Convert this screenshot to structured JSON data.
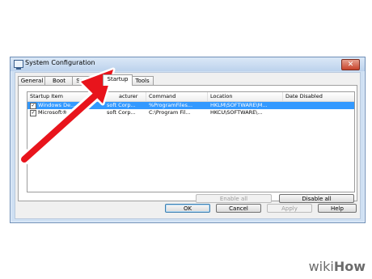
{
  "window": {
    "title": "System Configuration",
    "close_glyph": "✕"
  },
  "tabs": [
    {
      "label": "General"
    },
    {
      "label": "Boot"
    },
    {
      "label": "Services"
    },
    {
      "label": "Startup",
      "active": true
    },
    {
      "label": "Tools"
    }
  ],
  "table": {
    "columns": [
      "Startup Item",
      "Manufacturer",
      "Command",
      "Location",
      "Date Disabled"
    ],
    "header_visible": [
      "Startup Item",
      "acturer",
      "Command",
      "Location",
      "Date Disabled"
    ],
    "rows": [
      {
        "checked": true,
        "item": "Windows De...",
        "manufacturer": "soft Corp...",
        "command": "%ProgramFiles...",
        "location": "HKLM\\SOFTWARE\\M...",
        "date_disabled": "",
        "selected": true
      },
      {
        "checked": true,
        "item": "Microsoft®...",
        "manufacturer": "soft Corp...",
        "command": "C:\\Program Fil...",
        "location": "HKCU\\SOFTWARE\\...",
        "date_disabled": "",
        "selected": false
      }
    ]
  },
  "buttons": {
    "enable_all": "Enable all",
    "disable_all": "Disable all",
    "ok": "OK",
    "cancel": "Cancel",
    "apply": "Apply",
    "help": "Help"
  },
  "logo": {
    "wiki": "wiki",
    "how": "How"
  },
  "colors": {
    "selection": "#3399ff",
    "arrow": "#e8141c"
  }
}
